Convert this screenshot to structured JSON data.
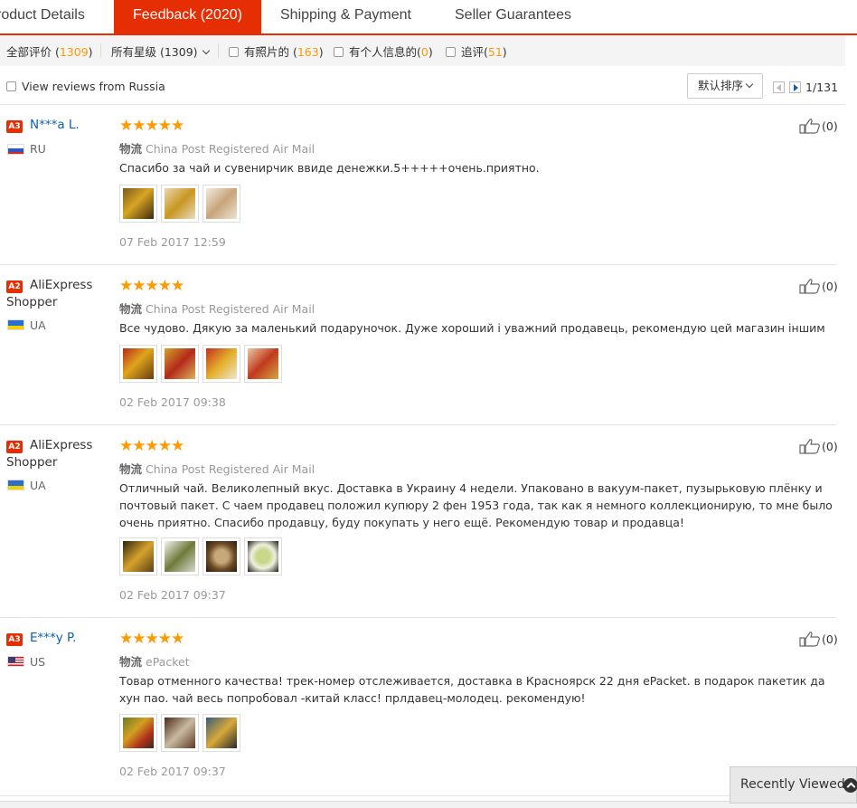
{
  "tabs": [
    {
      "label": "roduct Details",
      "active": false
    },
    {
      "label": "Feedback (2020)",
      "active": true
    },
    {
      "label": "Shipping & Payment",
      "active": false
    },
    {
      "label": "Seller Guarantees",
      "active": false
    }
  ],
  "filters": {
    "all_label": "全部评价 (",
    "all_count": "1309",
    "all_close": ")",
    "rating_label": "所有星级 (1309)",
    "photos_label": "有照片的 (",
    "photos_count": "163",
    "photos_close": ")",
    "personal_label": "有个人信息的(",
    "personal_count": "0",
    "personal_close": ")",
    "followup_label": "追评(",
    "followup_count": "51",
    "followup_close": ")"
  },
  "toolbar": {
    "russia_label": "View reviews from Russia",
    "sort_label": "默认排序",
    "page_text": "1/131"
  },
  "reviews": [
    {
      "level": "A3",
      "name": "N***a L.",
      "name2": "",
      "country": "RU",
      "stars": "★★★★★",
      "ship_label": "物流",
      "shipping": "China Post Registered Air Mail",
      "text": "Спасибо за чай и сувенирчик ввиде денежки.5+++++очень.приятно.",
      "date": "07 Feb 2017 12:59",
      "likes": "(0)"
    },
    {
      "level": "A2",
      "name": "AliExpress",
      "name2": "Shopper",
      "country": "UA",
      "stars": "★★★★★",
      "ship_label": "物流",
      "shipping": "China Post Registered Air Mail",
      "text": "Все чудово. Дякую за маленький подаруночок. Дуже хороший і уважний продавець, рекомендую цей магазин іншим",
      "date": "02 Feb 2017 09:38",
      "likes": "(0)"
    },
    {
      "level": "A2",
      "name": "AliExpress",
      "name2": "Shopper",
      "country": "UA",
      "stars": "★★★★★",
      "ship_label": "物流",
      "shipping": "China Post Registered Air Mail",
      "text": "Отличный чай. Великолепный вкус. Доставка в Украину 4 недели. Упаковано в вакуум-пакет, пузырьковую плёнку и почтовый пакет. С чаем продавец положил купюру 2 фен 1953 года, так как я немного коллекционирую, то мне было очень приятно. Спасибо продавцу, буду покупать у него ещё. Рекомендую товар и продавца!",
      "date": "02 Feb 2017 09:37",
      "likes": "(0)"
    },
    {
      "level": "A3",
      "name": "E***y P.",
      "name2": "",
      "country": "US",
      "stars": "★★★★★",
      "ship_label": "物流",
      "shipping": "ePacket",
      "text": "Товар отменного качества! трек-номер отслеживается, доставка в Красноярск 22 дня ePacket. в подарок пакетик да хун пао. чай весь попробовал -китай класс! прлдавец-молодец. рекомендую!",
      "date": "02 Feb 2017 09:37",
      "likes": "(0)"
    }
  ],
  "recently_viewed": "Recently Viewed",
  "icons": [
    "checkbox-icon",
    "chevron-down-icon",
    "prev-page-icon",
    "next-page-icon",
    "thumbs-up-icon",
    "flag-icon",
    "chevron-up-icon"
  ],
  "colors": {
    "accent": "#e62e04",
    "link": "#0b60b0",
    "star": "#ff9900",
    "count": "#ff9900"
  }
}
